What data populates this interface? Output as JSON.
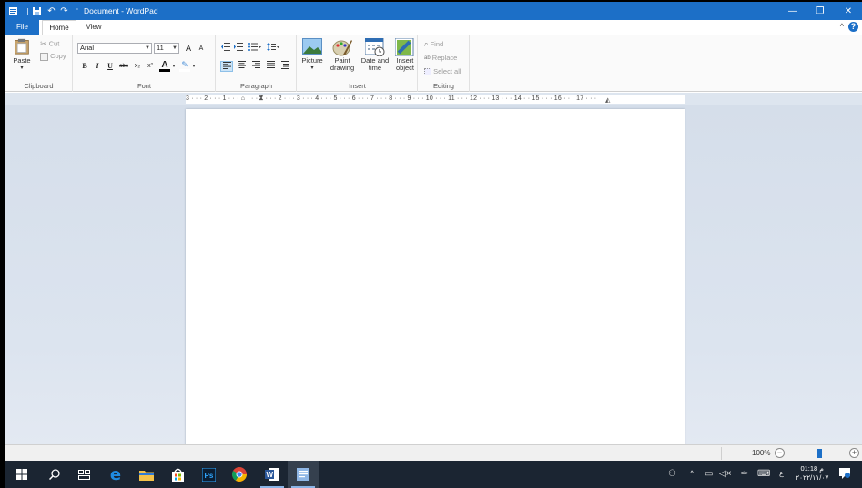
{
  "window": {
    "title": "Document - WordPad",
    "controls": {
      "minimize": "—",
      "maximize": "❐",
      "close": "✕"
    }
  },
  "tabs": [
    {
      "label": "File"
    },
    {
      "label": "Home"
    },
    {
      "label": "View"
    }
  ],
  "ribbon": {
    "clipboard": {
      "label": "Clipboard",
      "paste": "Paste",
      "paste_arrow": "▾",
      "cut": "Cut",
      "copy": "Copy"
    },
    "font": {
      "label": "Font",
      "family": "Arial",
      "size": "11",
      "grow": "A",
      "shrink": "A",
      "bold": "B",
      "italic": "I",
      "underline": "U",
      "strike": "abc",
      "subscript": "x₂",
      "superscript": "x²",
      "color": "A",
      "highlight": "✎"
    },
    "paragraph": {
      "label": "Paragraph"
    },
    "insert": {
      "label": "Insert",
      "picture": "Picture",
      "picture_arrow": "▾",
      "paint1": "Paint",
      "paint2": "drawing",
      "date1": "Date and",
      "date2": "time",
      "object1": "Insert",
      "object2": "object"
    },
    "editing": {
      "label": "Editing",
      "find": "Find",
      "replace": "Replace",
      "select_all": "Select all"
    }
  },
  "ruler": {
    "text": "3 · · · 2 · · · 1 · · · ⌂ · · · 1 · · · 2 · · · 3 · · · 4 · · · 5 · · · 6 · · · 7 · · · 8 · · · 9 · · · 10 · · · 11 · · · 12 · · · 13 · · · 14 · · 15 · · · 16 · · · 17 · · ·"
  },
  "status": {
    "zoom": "100%",
    "zoom_out": "−",
    "zoom_in": "+",
    "zoom_level": 0.55
  },
  "taskbar": {
    "time": "01:18 م",
    "date": "٢٠٢٢/١١/٠٧",
    "language": "ع"
  },
  "colors": {
    "accent": "#1c6fc7",
    "taskbar": "#1b2532"
  }
}
